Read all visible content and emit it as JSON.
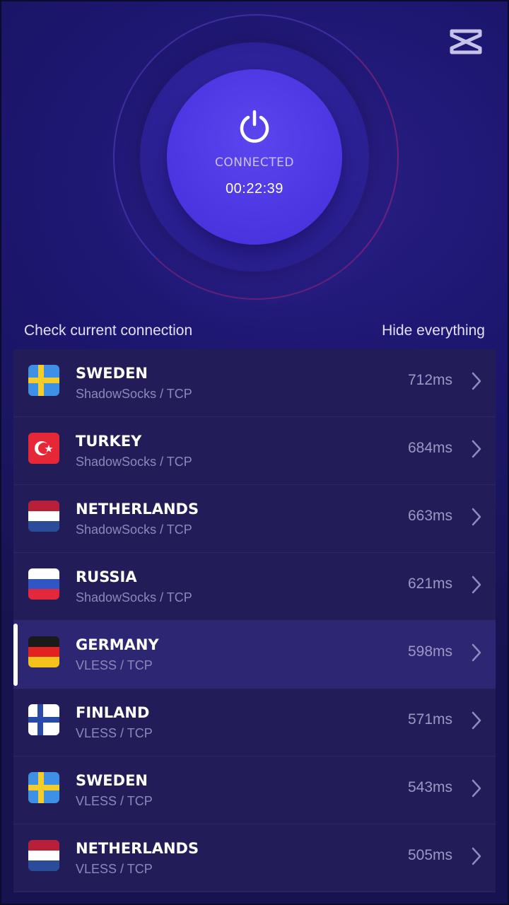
{
  "connection": {
    "status": "CONNECTED",
    "timer": "00:22:39",
    "power_icon": "power-icon"
  },
  "header": {
    "logo_icon": "capcut-logo-icon"
  },
  "links": {
    "check": "Check current connection",
    "hide": "Hide everything"
  },
  "servers": [
    {
      "country": "SWEDEN",
      "protocol": "ShadowSocks / TCP",
      "ping": "712ms",
      "flag": "sweden-flag-icon"
    },
    {
      "country": "TURKEY",
      "protocol": "ShadowSocks / TCP",
      "ping": "684ms",
      "flag": "turkey-flag-icon"
    },
    {
      "country": "NETHERLANDS",
      "protocol": "ShadowSocks / TCP",
      "ping": "663ms",
      "flag": "netherlands-flag-icon"
    },
    {
      "country": "RUSSIA",
      "protocol": "ShadowSocks / TCP",
      "ping": "621ms",
      "flag": "russia-flag-icon"
    },
    {
      "country": "GERMANY",
      "protocol": "VLESS / TCP",
      "ping": "598ms",
      "flag": "germany-flag-icon",
      "selected": true
    },
    {
      "country": "FINLAND",
      "protocol": "VLESS / TCP",
      "ping": "571ms",
      "flag": "finland-flag-icon"
    },
    {
      "country": "SWEDEN",
      "protocol": "VLESS / TCP",
      "ping": "543ms",
      "flag": "sweden-flag-icon"
    },
    {
      "country": "NETHERLANDS",
      "protocol": "VLESS / TCP",
      "ping": "505ms",
      "flag": "netherlands-flag-icon"
    }
  ],
  "colors": {
    "background": "#1c1770",
    "power_disc": "#4d38e4",
    "row": "#221d58",
    "row_selected": "#2c2673",
    "subtext": "#8d88b9"
  }
}
